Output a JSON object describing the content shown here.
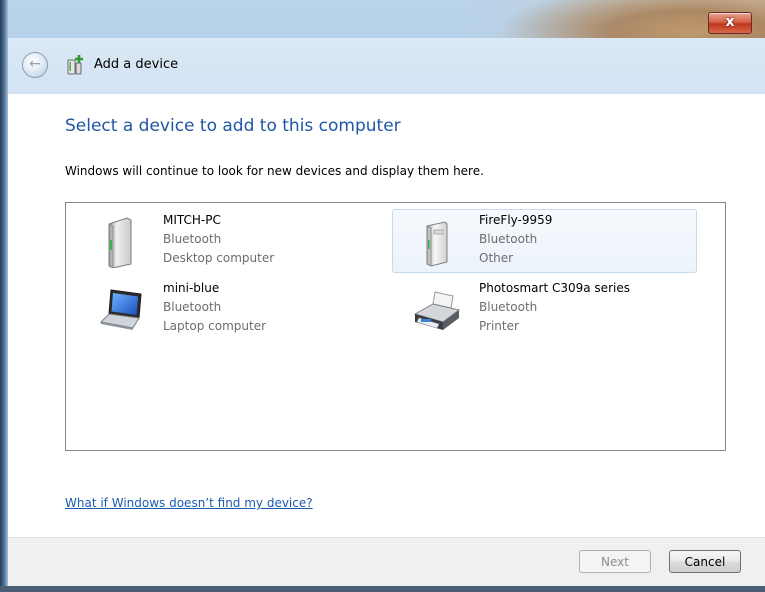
{
  "window": {
    "title": "Add a device",
    "close_label": "x"
  },
  "header": {
    "back_arrow": "←"
  },
  "main": {
    "heading": "Select a device to add to this computer",
    "subtitle": "Windows will continue to look for new devices and display them here.",
    "devices": [
      {
        "name": "MITCH-PC",
        "connection": "Bluetooth",
        "kind": "Desktop computer",
        "icon": "desktop-tower-icon",
        "selected": false
      },
      {
        "name": "FireFly-9959",
        "connection": "Bluetooth",
        "kind": "Other",
        "icon": "generic-device-icon",
        "selected": true
      },
      {
        "name": "mini-blue",
        "connection": "Bluetooth",
        "kind": "Laptop computer",
        "icon": "laptop-icon",
        "selected": false
      },
      {
        "name": "Photosmart C309a series",
        "connection": "Bluetooth",
        "kind": "Printer",
        "icon": "printer-icon",
        "selected": false
      }
    ],
    "help_link": "What if Windows doesn’t find my device?"
  },
  "footer": {
    "next_label": "Next",
    "cancel_label": "Cancel",
    "next_enabled": false
  },
  "colors": {
    "heading": "#1f56a5",
    "link": "#1c5bb4",
    "selection": "#c8d9ee"
  }
}
